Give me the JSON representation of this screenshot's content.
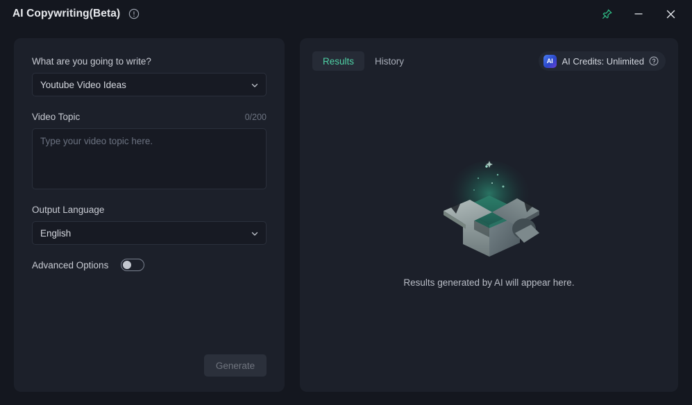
{
  "window": {
    "title": "AI Copywriting(Beta)",
    "info_icon": "info-circle-icon",
    "pin_icon": "pin-icon",
    "minimize_icon": "minimize-icon",
    "close_icon": "close-icon",
    "pin_color": "#2fbd86"
  },
  "left_panel": {
    "prompt_label": "What are you going to write?",
    "template_select": {
      "value": "Youtube Video Ideas",
      "chevron_icon": "chevron-down-icon"
    },
    "topic": {
      "label": "Video Topic",
      "counter": "0/200",
      "value": "",
      "placeholder": "Type your video topic here."
    },
    "language": {
      "label": "Output Language",
      "value": "English",
      "chevron_icon": "chevron-down-icon"
    },
    "advanced": {
      "label": "Advanced Options",
      "state": "off"
    },
    "generate_label": "Generate"
  },
  "right_panel": {
    "tabs": [
      {
        "label": "Results",
        "active": true
      },
      {
        "label": "History",
        "active": false
      }
    ],
    "credits": {
      "badge_text": "AI",
      "label": "AI Credits: Unlimited",
      "help_icon": "help-circle-icon"
    },
    "empty_state": {
      "illustration": "open-box-icon",
      "message": "Results generated by AI will appear here."
    }
  },
  "colors": {
    "background": "#14171f",
    "panel": "#1c202a",
    "accent_green": "#4fd1a5",
    "field": "#171a23"
  }
}
